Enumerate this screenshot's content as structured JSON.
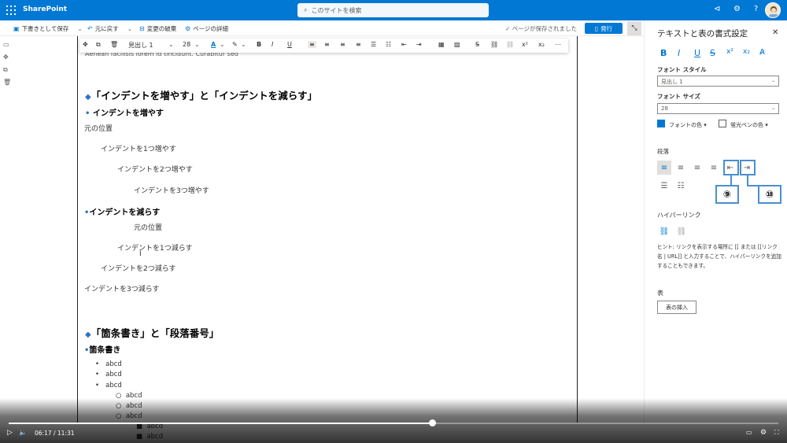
{
  "topbar": {
    "app_name": "SharePoint",
    "search_placeholder": "このサイトを検索"
  },
  "commandbar": {
    "save_draft": "下書きとして保存",
    "undo": "元に戻す",
    "discard": "変更の破棄",
    "page_details": "ページの詳細",
    "saved_status": "ページが保存されました",
    "publish": "発行"
  },
  "rte": {
    "style": "見出し 1",
    "size": "28"
  },
  "doc": {
    "cut_line": "Aenean facilisis lorem id tincidunt. Curabitur sed",
    "h_indent": "「インデントを増やす」と「インデントを減らす」",
    "h_increase": "インデントを増やす",
    "orig1": "元の位置",
    "inc1": "インデントを1つ増やす",
    "inc2": "インデントを2つ増やす",
    "inc3": "インデントを3つ増やす",
    "h_decrease": "インデントを減らす",
    "orig2": "元の位置",
    "dec1": "インデントを1つ減らす",
    "dec2": "インデントを2つ減らす",
    "dec3": "インデントを3つ減らす",
    "h_list": "「箇条書き」と「段落番号」",
    "h_bullets": "箇条書き",
    "items": [
      "abcd",
      "abcd",
      "abcd",
      "abcd",
      "abcd",
      "abcd",
      "abcd",
      "abcd"
    ]
  },
  "panel": {
    "title": "テキストと表の書式設定",
    "font_style_label": "フォント スタイル",
    "font_style_value": "見出し 1",
    "font_size_label": "フォント サイズ",
    "font_size_value": "28",
    "font_color": "フォントの色",
    "highlight_color": "蛍光ペンの色",
    "paragraph_label": "段落",
    "callout_9": "⑨",
    "callout_10": "⑩",
    "hyperlink_label": "ハイパーリンク",
    "hint": "ヒント: リンクを表示する場所に [[ または [[リンク名 | URL]] と入力することで、ハイパーリンクを追加することもできます。",
    "table_label": "表",
    "insert_table": "表の挿入"
  },
  "player": {
    "time": "06:17 / 11:31",
    "progress": 0.55
  },
  "colors": {
    "brand": "#0078d4",
    "accent_diamond": "#2b73c5",
    "callout": "#4a8fd0"
  }
}
